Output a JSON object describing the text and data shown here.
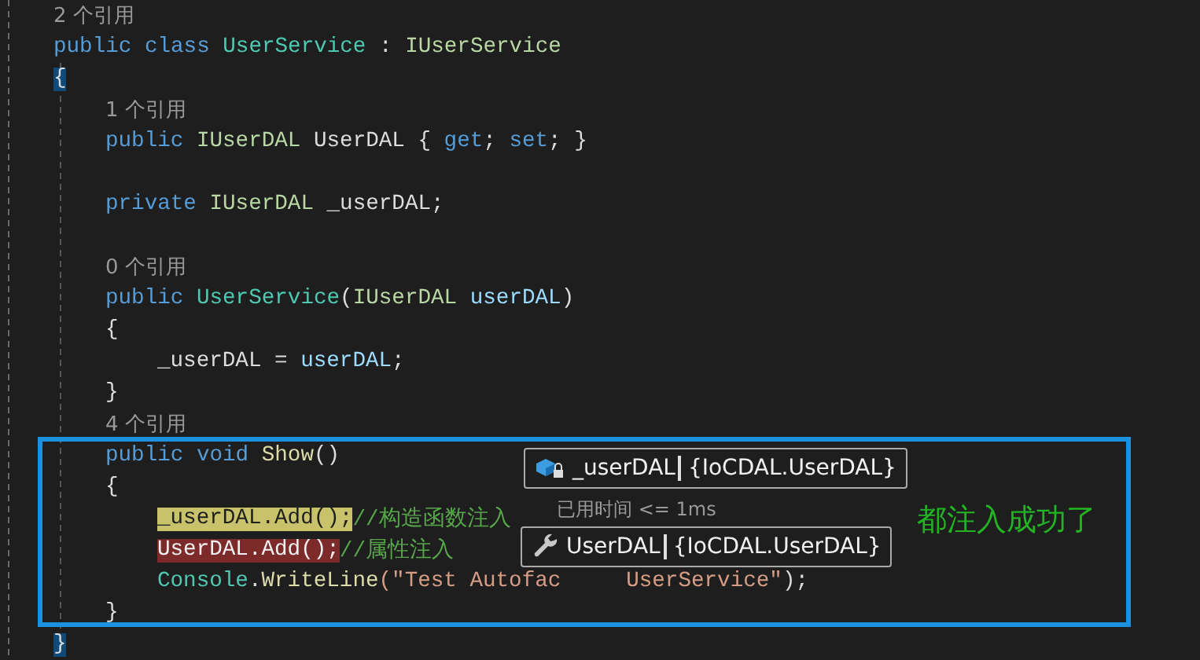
{
  "code_lines": [
    {
      "kind": "codelens",
      "text": "2 个引用"
    },
    {
      "kind": "code",
      "segments": [
        {
          "text": "public class ",
          "kind": "keyword"
        },
        {
          "text": "UserService",
          "kind": "type"
        },
        {
          "text": " : ",
          "kind": "plain"
        },
        {
          "text": "IUserService",
          "kind": "interface"
        }
      ]
    },
    {
      "kind": "code",
      "segments": [
        {
          "text": "{",
          "kind": "brace-match"
        }
      ],
      "children": [
        {
          "kind": "codelens",
          "text": "1 个引用"
        },
        {
          "kind": "code",
          "segments": [
            {
              "text": "public ",
              "kind": "keyword"
            },
            {
              "text": "IUserDAL",
              "kind": "interface"
            },
            {
              "text": " UserDAL { ",
              "kind": "plain"
            },
            {
              "text": "get",
              "kind": "keyword"
            },
            {
              "text": "; ",
              "kind": "plain"
            },
            {
              "text": "set",
              "kind": "keyword"
            },
            {
              "text": "; }",
              "kind": "plain"
            }
          ]
        },
        {
          "kind": "code",
          "blank_line_before": true,
          "segments": [
            {
              "text": "private ",
              "kind": "keyword"
            },
            {
              "text": "IUserDAL",
              "kind": "interface"
            },
            {
              "text": " _userDAL;",
              "kind": "plain"
            }
          ]
        },
        {
          "kind": "codelens",
          "blank_line_before": true,
          "text": "0 个引用"
        },
        {
          "kind": "code",
          "segments": [
            {
              "text": "public ",
              "kind": "keyword"
            },
            {
              "text": "UserService",
              "kind": "type"
            },
            {
              "text": "(",
              "kind": "plain"
            },
            {
              "text": "IUserDAL",
              "kind": "interface"
            },
            {
              "text": " userDAL",
              "kind": "param"
            },
            {
              "text": ")",
              "kind": "plain"
            }
          ]
        },
        {
          "kind": "code",
          "segments": [
            {
              "text": "{",
              "kind": "plain"
            }
          ],
          "children": [
            {
              "kind": "code",
              "segments": [
                {
                  "text": "_userDAL = ",
                  "kind": "plain"
                },
                {
                  "text": "userDAL",
                  "kind": "param"
                },
                {
                  "text": ";",
                  "kind": "plain"
                }
              ]
            }
          ]
        },
        {
          "kind": "code",
          "segments": [
            {
              "text": "}",
              "kind": "plain"
            }
          ]
        },
        {
          "kind": "codelens",
          "text": "4 个引用"
        },
        {
          "kind": "code",
          "segments": [
            {
              "text": "public void ",
              "kind": "keyword"
            },
            {
              "text": "Show",
              "kind": "method"
            },
            {
              "text": "()",
              "kind": "plain"
            }
          ]
        },
        {
          "kind": "code",
          "segments": [
            {
              "text": "{",
              "kind": "plain"
            }
          ],
          "children": [
            {
              "kind": "code",
              "segments": [
                {
                  "text": "_userDAL.Add();",
                  "kind": "current-statement"
                },
                {
                  "text": "//构造函数注入",
                  "kind": "comment"
                }
              ]
            },
            {
              "kind": "code",
              "segments": [
                {
                  "text": "UserDAL.Add();",
                  "kind": "breakpoint"
                },
                {
                  "text": "//属性注入",
                  "kind": "comment"
                }
              ]
            },
            {
              "kind": "code",
              "segments": [
                {
                  "text": "Console",
                  "kind": "type"
                },
                {
                  "text": ".",
                  "kind": "plain"
                },
                {
                  "text": "WriteLine",
                  "kind": "method"
                },
                {
                  "text": "(\"Test Autofac",
                  "kind": "string"
                },
                {
                  "text": "     UserService\"",
                  "kind": "string"
                },
                {
                  "text": ");",
                  "kind": "plain"
                }
              ]
            }
          ]
        },
        {
          "kind": "code",
          "segments": [
            {
              "text": "}",
              "kind": "plain"
            }
          ]
        }
      ]
    },
    {
      "kind": "code",
      "segments": [
        {
          "text": "}",
          "kind": "brace-match"
        }
      ]
    }
  ],
  "datatips": [
    {
      "kind": "field",
      "name": "_userDAL",
      "value": "{IoCDAL.UserDAL}"
    },
    {
      "kind": "property",
      "name": "UserDAL",
      "value": "{IoCDAL.UserDAL}"
    }
  ],
  "elapsed_time": "已用时间 <= 1ms",
  "annotation": "都注入成功了"
}
